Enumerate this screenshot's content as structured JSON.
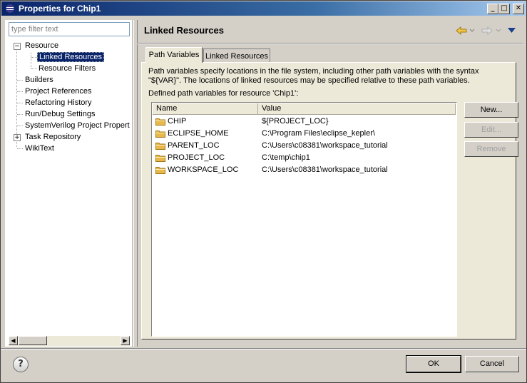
{
  "window": {
    "title": "Properties for Chip1"
  },
  "titlebar_buttons": {
    "minimize": "_",
    "maximize": "□",
    "close": "✕"
  },
  "filter": {
    "placeholder": "type filter text"
  },
  "tree": {
    "items": [
      {
        "label": "Resource",
        "expander": "−"
      },
      {
        "label": "Linked Resources",
        "selected": true
      },
      {
        "label": "Resource Filters"
      },
      {
        "label": "Builders"
      },
      {
        "label": "Project References"
      },
      {
        "label": "Refactoring History"
      },
      {
        "label": "Run/Debug Settings"
      },
      {
        "label": "SystemVerilog Project Propert"
      },
      {
        "label": "Task Repository",
        "expander": "+"
      },
      {
        "label": "WikiText"
      }
    ]
  },
  "page": {
    "title": "Linked Resources"
  },
  "tabs": [
    {
      "label": "Path Variables",
      "active": true
    },
    {
      "label": "Linked Resources",
      "active": false
    }
  ],
  "description": "Path variables specify locations in the file system, including other path variables with the syntax \"${VAR}\". The locations of linked resources may be specified relative to these path variables.",
  "defined_label": "Defined path variables for resource 'Chip1':",
  "table": {
    "columns": [
      "Name",
      "Value"
    ],
    "rows": [
      {
        "name": "CHIP",
        "value": "${PROJECT_LOC}"
      },
      {
        "name": "ECLIPSE_HOME",
        "value": "C:\\Program Files\\eclipse_kepler\\"
      },
      {
        "name": "PARENT_LOC",
        "value": "C:\\Users\\c08381\\workspace_tutorial"
      },
      {
        "name": "PROJECT_LOC",
        "value": "C:\\temp\\chip1"
      },
      {
        "name": "WORKSPACE_LOC",
        "value": "C:\\Users\\c08381\\workspace_tutorial"
      }
    ]
  },
  "buttons": {
    "new": "New...",
    "edit": "Edit...",
    "remove": "Remove"
  },
  "dialog": {
    "help": "?",
    "ok": "OK",
    "cancel": "Cancel"
  },
  "colors": {
    "accent": "#0a246a",
    "folder": "#e8b84a"
  }
}
